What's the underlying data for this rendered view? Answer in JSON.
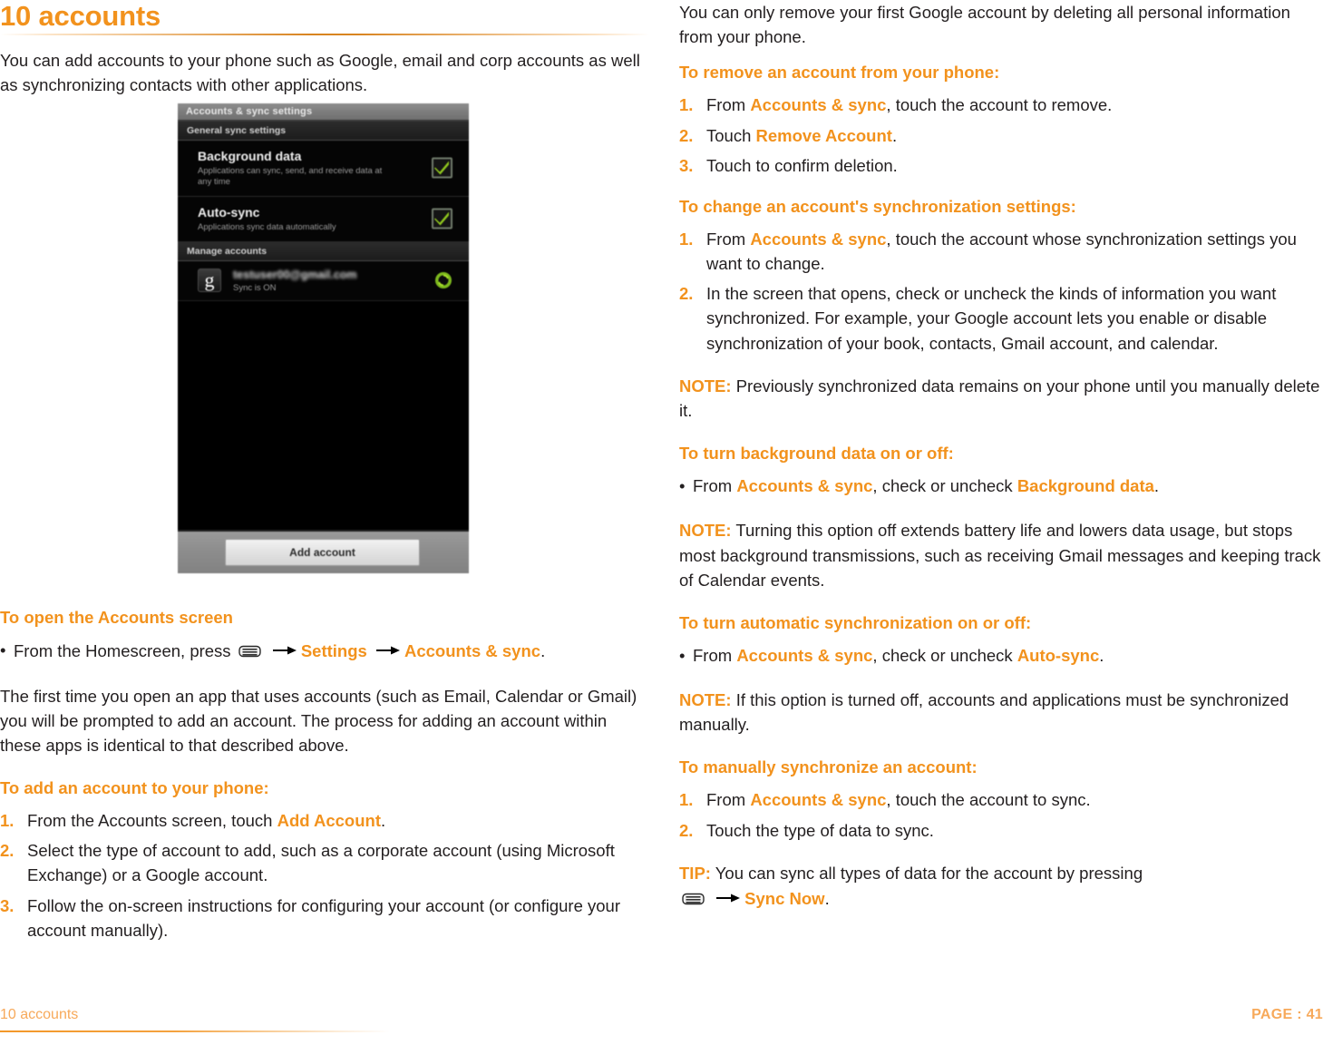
{
  "chapter": {
    "title": "10 accounts",
    "intro": "You can add accounts to your phone such as Google, email and corp accounts as well as synchronizing contacts with other applications."
  },
  "screenshot": {
    "titlebar": "Accounts & sync settings",
    "section_general": "General sync settings",
    "rows": [
      {
        "title": "Background data",
        "subtitle": "Applications can sync, send, and receive data at any time",
        "checked": true
      },
      {
        "title": "Auto-sync",
        "subtitle": "Applications sync data automatically",
        "checked": true
      }
    ],
    "section_manage": "Manage accounts",
    "account": {
      "icon": "g",
      "email": "testuser00@gmail.com",
      "status": "Sync is ON"
    },
    "add_account_button": "Add account"
  },
  "left_column": {
    "open_accounts": {
      "heading": "To open the Accounts screen",
      "bullet_pre": "From the Homescreen, press",
      "link_settings": "Settings",
      "link_accounts_sync": "Accounts & sync",
      "period": "."
    },
    "first_time_paragraph": "The first time you open an app that uses accounts (such as Email, Calendar or Gmail) you will be prompted to add an account. The process for adding an account within these apps is identical to that described above.",
    "add_account": {
      "heading": "To add an account to your phone:",
      "steps": [
        {
          "num": "1.",
          "pre": "From the Accounts screen, touch ",
          "link": "Add Account",
          "post": "."
        },
        {
          "num": "2.",
          "pre": "Select the type of account to add, such as a corporate account (using Microsoft Exchange) or a Google account.",
          "link": "",
          "post": ""
        },
        {
          "num": "3.",
          "pre": "Follow the on-screen instructions for configuring your account (or configure your account manually).",
          "link": "",
          "post": ""
        }
      ]
    }
  },
  "right_column": {
    "remove_first_paragraph": "You can only remove your first Google account by deleting all personal information from your phone.",
    "remove_account": {
      "heading": "To remove an account from your phone:",
      "steps": [
        {
          "num": "1.",
          "pre": "From ",
          "link": "Accounts & sync",
          "post": ", touch the account to remove."
        },
        {
          "num": "2.",
          "pre": "Touch ",
          "link": "Remove Account",
          "post": "."
        },
        {
          "num": "3.",
          "pre": "Touch to confirm deletion.",
          "link": "",
          "post": ""
        }
      ]
    },
    "change_sync": {
      "heading": "To change an account's synchronization settings:",
      "steps": [
        {
          "num": "1.",
          "pre": "From ",
          "link": "Accounts & sync",
          "post": ", touch the account whose synchronization settings you want to change."
        },
        {
          "num": "2.",
          "pre": "In the screen that opens, check or uncheck the kinds of information you want synchronized. For example, your Google account lets you enable or disable synchronization of your book, contacts, Gmail account, and calendar.",
          "link": "",
          "post": ""
        }
      ]
    },
    "note_1": {
      "label": "NOTE:",
      "text": " Previously synchronized data remains on your phone until you manually delete it."
    },
    "background_data": {
      "heading": "To turn background data on or off:",
      "bullet": {
        "pre": "From ",
        "link1": "Accounts & sync",
        "mid": ", check or uncheck ",
        "link2": "Background data",
        "post": "."
      }
    },
    "note_2": {
      "label": "NOTE:",
      "text": " Turning this option off extends battery life and lowers data usage, but stops most background transmissions, such as receiving Gmail messages and keeping track of Calendar events."
    },
    "auto_sync": {
      "heading": "To turn automatic synchronization on or off:",
      "bullet": {
        "pre": "From ",
        "link1": "Accounts & sync",
        "mid": ", check or uncheck ",
        "link2": "Auto-sync",
        "post": "."
      }
    },
    "note_3": {
      "label": "NOTE:",
      "text": " If this option is turned off, accounts and applications must be synchronized manually."
    },
    "manual_sync": {
      "heading": "To manually synchronize an account:",
      "steps": [
        {
          "num": "1.",
          "pre": "From ",
          "link": "Accounts & sync",
          "post": ", touch the account to sync."
        },
        {
          "num": "2.",
          "pre": "Touch the type of data to sync.",
          "link": "",
          "post": ""
        }
      ]
    },
    "tip": {
      "label": "TIP:",
      "text": " You can sync all types of data for the account by pressing",
      "link": "Sync Now",
      "post": "."
    }
  },
  "footer": {
    "left": "10 accounts",
    "right": "PAGE : 41"
  },
  "colors": {
    "accent": "#f2921d",
    "footer_accent": "#f7a95a",
    "body_text": "#231f20"
  }
}
